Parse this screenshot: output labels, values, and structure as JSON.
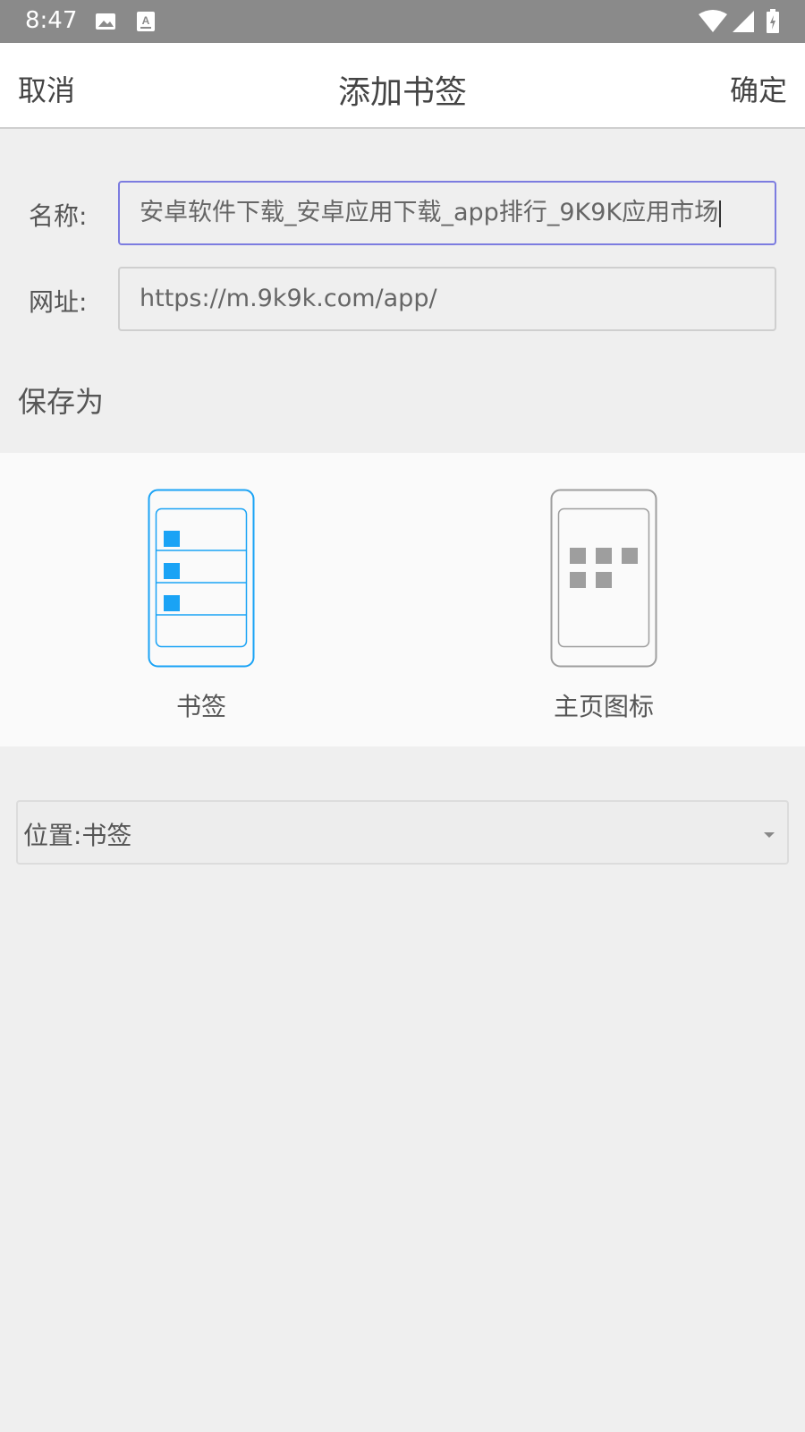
{
  "status_bar": {
    "time": "8:47",
    "icons_left": [
      "image-icon",
      "keyboard-a-icon"
    ],
    "icons_right": [
      "wifi-icon",
      "signal-icon",
      "battery-icon"
    ]
  },
  "toolbar": {
    "cancel_label": "取消",
    "title": "添加书签",
    "confirm_label": "确定"
  },
  "form": {
    "name_label": "名称:",
    "name_value": "安卓软件下载_安卓应用下载_app排行_9K9K应用市场",
    "url_label": "网址:",
    "url_value": "https://m.9k9k.com/app/"
  },
  "save_as": {
    "label": "保存为",
    "options": [
      {
        "label": "书签",
        "icon": "bookmark-list-icon",
        "selected": true
      },
      {
        "label": "主页图标",
        "icon": "home-grid-icon",
        "selected": false
      }
    ]
  },
  "location": {
    "text": "位置:书签"
  },
  "colors": {
    "accent": "#1aa3f5",
    "focus_border": "#7c7ce0",
    "status_bar": "#8a8a8a",
    "icon_gray": "#9e9e9e"
  }
}
